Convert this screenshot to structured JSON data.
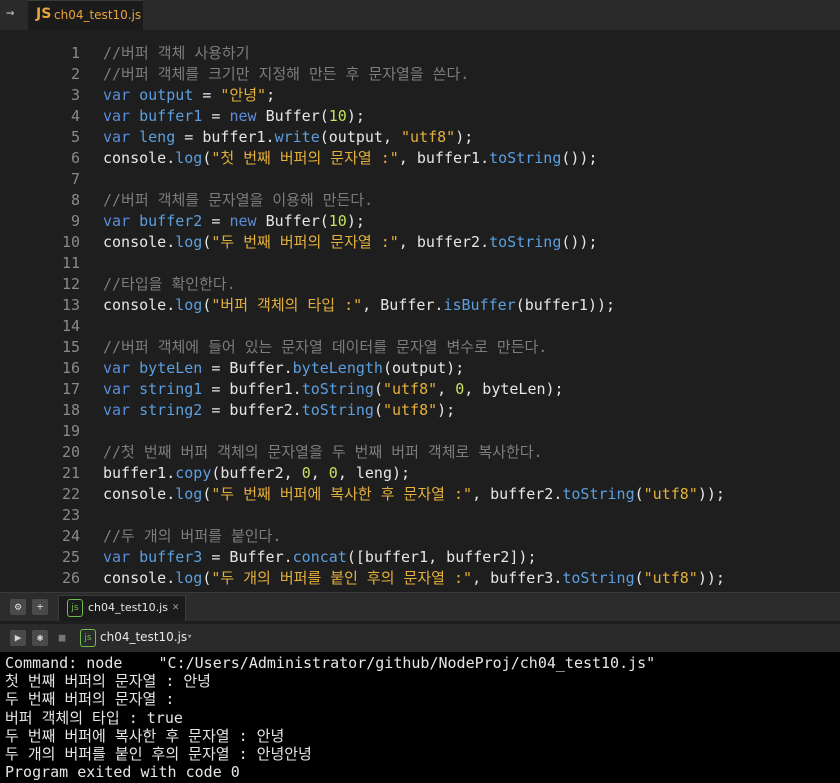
{
  "top_tab": {
    "badge": "JS",
    "filename": "ch04_test10.js",
    "back": "→"
  },
  "editor": {
    "lines": [
      {
        "n": "1",
        "tokens": [
          [
            "cm",
            "//버퍼 객체 사용하기"
          ]
        ]
      },
      {
        "n": "2",
        "tokens": [
          [
            "cm",
            "//버퍼 객체를 크기만 지정해 만든 후 문자열을 쓴다."
          ]
        ]
      },
      {
        "n": "3",
        "tokens": [
          [
            "kw",
            "var "
          ],
          [
            "vr",
            "output"
          ],
          [
            "txt",
            " = "
          ],
          [
            "str",
            "\"안녕\""
          ],
          [
            "txt",
            ";"
          ]
        ]
      },
      {
        "n": "4",
        "tokens": [
          [
            "kw",
            "var "
          ],
          [
            "vr",
            "buffer1"
          ],
          [
            "txt",
            " = "
          ],
          [
            "kw",
            "new "
          ],
          [
            "txt",
            "Buffer("
          ],
          [
            "num",
            "10"
          ],
          [
            "txt",
            ");"
          ]
        ]
      },
      {
        "n": "5",
        "tokens": [
          [
            "kw",
            "var "
          ],
          [
            "vr",
            "leng"
          ],
          [
            "txt",
            " = buffer1."
          ],
          [
            "fn",
            "write"
          ],
          [
            "txt",
            "(output, "
          ],
          [
            "str",
            "\"utf8\""
          ],
          [
            "txt",
            ");"
          ]
        ]
      },
      {
        "n": "6",
        "tokens": [
          [
            "txt",
            "console."
          ],
          [
            "fn",
            "log"
          ],
          [
            "txt",
            "("
          ],
          [
            "str",
            "\"첫 번째 버퍼의 문자열 :\""
          ],
          [
            "txt",
            ", buffer1."
          ],
          [
            "fn",
            "toString"
          ],
          [
            "txt",
            "());"
          ]
        ]
      },
      {
        "n": "7",
        "tokens": []
      },
      {
        "n": "8",
        "tokens": [
          [
            "cm",
            "//버퍼 객체를 문자열을 이용해 만든다."
          ]
        ]
      },
      {
        "n": "9",
        "tokens": [
          [
            "kw",
            "var "
          ],
          [
            "vr",
            "buffer2"
          ],
          [
            "txt",
            " = "
          ],
          [
            "kw",
            "new "
          ],
          [
            "txt",
            "Buffer("
          ],
          [
            "num",
            "10"
          ],
          [
            "txt",
            ");"
          ]
        ]
      },
      {
        "n": "10",
        "tokens": [
          [
            "txt",
            "console."
          ],
          [
            "fn",
            "log"
          ],
          [
            "txt",
            "("
          ],
          [
            "str",
            "\"두 번째 버퍼의 문자열 :\""
          ],
          [
            "txt",
            ", buffer2."
          ],
          [
            "fn",
            "toString"
          ],
          [
            "txt",
            "());"
          ]
        ]
      },
      {
        "n": "11",
        "tokens": []
      },
      {
        "n": "12",
        "tokens": [
          [
            "cm",
            "//타입을 확인한다."
          ]
        ]
      },
      {
        "n": "13",
        "tokens": [
          [
            "txt",
            "console."
          ],
          [
            "fn",
            "log"
          ],
          [
            "txt",
            "("
          ],
          [
            "str",
            "\"버퍼 객체의 타입 :\""
          ],
          [
            "txt",
            ", Buffer."
          ],
          [
            "fn",
            "isBuffer"
          ],
          [
            "txt",
            "(buffer1));"
          ]
        ]
      },
      {
        "n": "14",
        "tokens": []
      },
      {
        "n": "15",
        "tokens": [
          [
            "cm",
            "//버퍼 객체에 들어 있는 문자열 데이터를 문자열 변수로 만든다."
          ]
        ]
      },
      {
        "n": "16",
        "tokens": [
          [
            "kw",
            "var "
          ],
          [
            "vr",
            "byteLen"
          ],
          [
            "txt",
            " = Buffer."
          ],
          [
            "fn",
            "byteLength"
          ],
          [
            "txt",
            "(output);"
          ]
        ]
      },
      {
        "n": "17",
        "tokens": [
          [
            "kw",
            "var "
          ],
          [
            "vr",
            "string1"
          ],
          [
            "txt",
            " = buffer1."
          ],
          [
            "fn",
            "toString"
          ],
          [
            "txt",
            "("
          ],
          [
            "str",
            "\"utf8\""
          ],
          [
            "txt",
            ", "
          ],
          [
            "num",
            "0"
          ],
          [
            "txt",
            ", byteLen);"
          ]
        ]
      },
      {
        "n": "18",
        "tokens": [
          [
            "kw",
            "var "
          ],
          [
            "vr",
            "string2"
          ],
          [
            "txt",
            " = buffer2."
          ],
          [
            "fn",
            "toString"
          ],
          [
            "txt",
            "("
          ],
          [
            "str",
            "\"utf8\""
          ],
          [
            "txt",
            ");"
          ]
        ]
      },
      {
        "n": "19",
        "tokens": []
      },
      {
        "n": "20",
        "tokens": [
          [
            "cm",
            "//첫 번째 버퍼 객체의 문자열을 두 번째 버퍼 객체로 복사한다."
          ]
        ]
      },
      {
        "n": "21",
        "tokens": [
          [
            "txt",
            "buffer1."
          ],
          [
            "fn",
            "copy"
          ],
          [
            "txt",
            "(buffer2, "
          ],
          [
            "num",
            "0"
          ],
          [
            "txt",
            ", "
          ],
          [
            "num",
            "0"
          ],
          [
            "txt",
            ", leng);"
          ]
        ]
      },
      {
        "n": "22",
        "tokens": [
          [
            "txt",
            "console."
          ],
          [
            "fn",
            "log"
          ],
          [
            "txt",
            "("
          ],
          [
            "str",
            "\"두 번째 버퍼에 복사한 후 문자열 :\""
          ],
          [
            "txt",
            ", buffer2."
          ],
          [
            "fn",
            "toString"
          ],
          [
            "txt",
            "("
          ],
          [
            "str",
            "\"utf8\""
          ],
          [
            "txt",
            "));"
          ]
        ]
      },
      {
        "n": "23",
        "tokens": []
      },
      {
        "n": "24",
        "tokens": [
          [
            "cm",
            "//두 개의 버퍼를 붙인다."
          ]
        ]
      },
      {
        "n": "25",
        "tokens": [
          [
            "kw",
            "var "
          ],
          [
            "vr",
            "buffer3"
          ],
          [
            "txt",
            " = Buffer."
          ],
          [
            "fn",
            "concat"
          ],
          [
            "txt",
            "([buffer1, buffer2]);"
          ]
        ]
      },
      {
        "n": "26",
        "tokens": [
          [
            "txt",
            "console."
          ],
          [
            "fn",
            "log"
          ],
          [
            "txt",
            "("
          ],
          [
            "str",
            "\"두 개의 버퍼를 붙인 후의 문자열 :\""
          ],
          [
            "txt",
            ", buffer3."
          ],
          [
            "fn",
            "toString"
          ],
          [
            "txt",
            "("
          ],
          [
            "str",
            "\"utf8\""
          ],
          [
            "txt",
            "));"
          ]
        ]
      }
    ]
  },
  "panel": {
    "settings_icon": "⚙",
    "add_icon": "+",
    "tab_label": "ch04_test10.js",
    "tab_icon_text": "js",
    "close_icon": "✕"
  },
  "runner": {
    "play_icon": "▶",
    "debug_icon": "✱",
    "stop_icon": "■",
    "file_label": "ch04_test10.js",
    "dropdown_icon": "▾",
    "icon_text": "js"
  },
  "console": {
    "lines": [
      "Command: node    \"C:/Users/Administrator/github/NodeProj/ch04_test10.js\"",
      "첫 번째 버퍼의 문자열 : 안녕",
      "두 번째 버퍼의 문자열 :",
      "버퍼 객체의 타입 : true",
      "두 번째 버퍼에 복사한 후 문자열 : 안녕",
      "두 개의 버퍼를 붙인 후의 문자열 : 안녕안녕",
      "Program exited with code 0"
    ]
  }
}
